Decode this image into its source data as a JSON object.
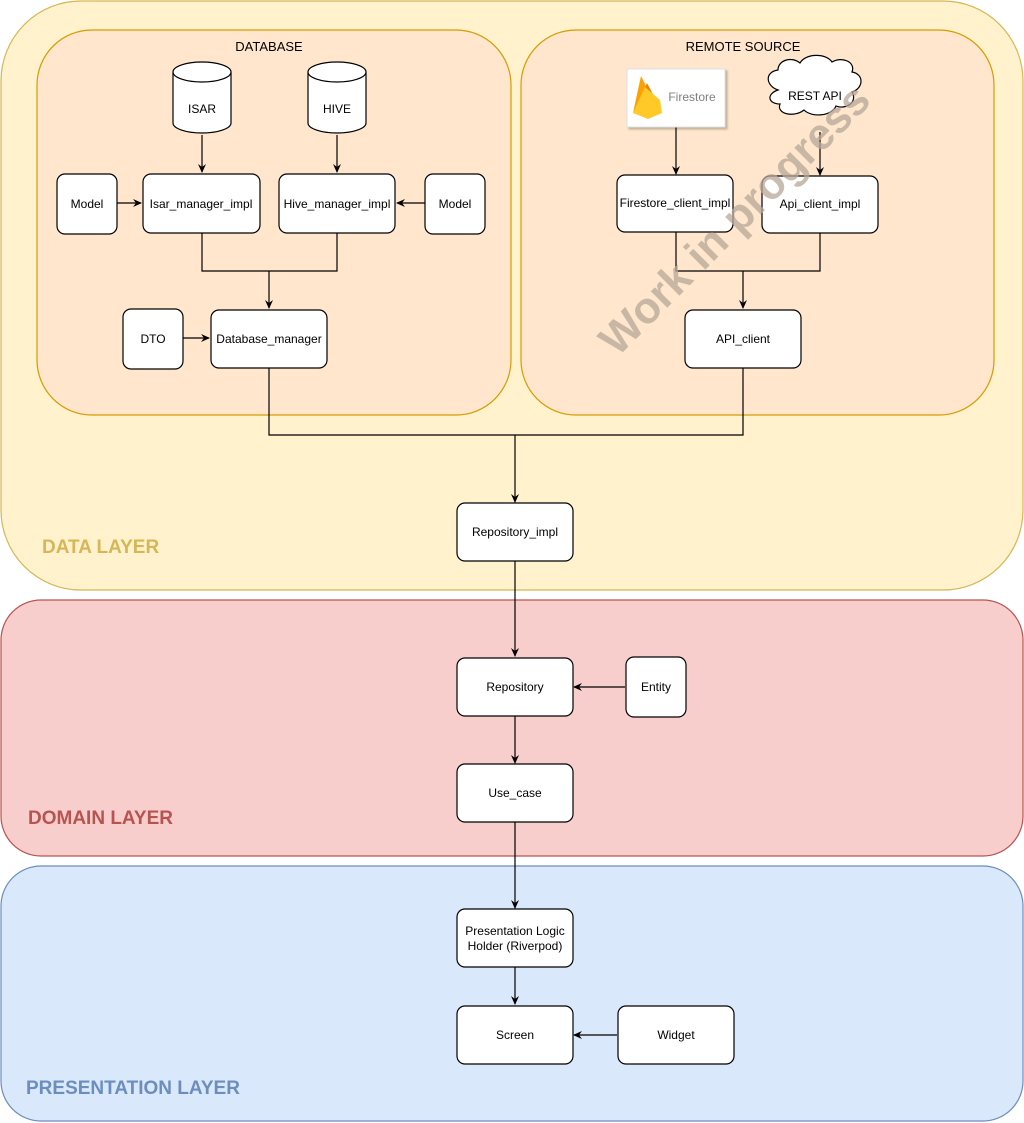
{
  "layers": {
    "data": {
      "label": "DATA LAYER",
      "fill": "#fff2cc",
      "stroke": "#d6b656",
      "label_color": "#d6b656"
    },
    "domain": {
      "label": "DOMAIN LAYER",
      "fill": "#f8cecc",
      "stroke": "#b85450",
      "label_color": "#b85450"
    },
    "presentation": {
      "label": "PRESENTATION LAYER",
      "fill": "#dae8fc",
      "stroke": "#6c8ebf",
      "label_color": "#6c8ebf"
    }
  },
  "groups": {
    "database": {
      "title": "DATABASE",
      "fill": "#ffe6cc",
      "stroke": "#d79b00"
    },
    "remote_source": {
      "title": "REMOTE SOURCE",
      "fill": "#ffe6cc",
      "stroke": "#d79b00"
    }
  },
  "nodes": {
    "isar": {
      "label": "ISAR",
      "shape": "cylinder"
    },
    "hive": {
      "label": "HIVE",
      "shape": "cylinder"
    },
    "model_left": {
      "label": "Model"
    },
    "isar_manager_impl": {
      "label": "Isar_manager_impl"
    },
    "hive_manager_impl": {
      "label": "Hive_manager_impl"
    },
    "model_right": {
      "label": "Model"
    },
    "dto": {
      "label": "DTO"
    },
    "database_manager": {
      "label": "Database_manager"
    },
    "firestore": {
      "label": "Firestore",
      "shape": "firebase-logo-card"
    },
    "rest_api": {
      "label": "REST API",
      "shape": "cloud"
    },
    "firestore_client_impl": {
      "label": "Firestore_client_impl"
    },
    "api_client_impl": {
      "label": "Api_client_impl"
    },
    "api_client": {
      "label": "API_client"
    },
    "repository_impl": {
      "label": "Repository_impl"
    },
    "repository": {
      "label": "Repository"
    },
    "entity": {
      "label": "Entity"
    },
    "use_case": {
      "label": "Use_case"
    },
    "presentation_logic_holder": {
      "label_line1": "Presentation Logic",
      "label_line2": "Holder (Riverpod)"
    },
    "screen": {
      "label": "Screen"
    },
    "widget": {
      "label": "Widget"
    }
  },
  "edges": [
    {
      "from": "ISAR",
      "to": "Isar_manager_impl"
    },
    {
      "from": "HIVE",
      "to": "Hive_manager_impl"
    },
    {
      "from": "Model",
      "to": "Isar_manager_impl"
    },
    {
      "from": "Model",
      "to": "Hive_manager_impl"
    },
    {
      "from": "Isar_manager_impl",
      "to": "Database_manager"
    },
    {
      "from": "Hive_manager_impl",
      "to": "Database_manager"
    },
    {
      "from": "DTO",
      "to": "Database_manager"
    },
    {
      "from": "Firestore",
      "to": "Firestore_client_impl"
    },
    {
      "from": "REST API",
      "to": "Api_client_impl"
    },
    {
      "from": "Firestore_client_impl",
      "to": "API_client"
    },
    {
      "from": "Api_client_impl",
      "to": "API_client"
    },
    {
      "from": "Database_manager",
      "to": "Repository_impl"
    },
    {
      "from": "API_client",
      "to": "Repository_impl"
    },
    {
      "from": "Repository_impl",
      "to": "Repository"
    },
    {
      "from": "Entity",
      "to": "Repository"
    },
    {
      "from": "Repository",
      "to": "Use_case"
    },
    {
      "from": "Use_case",
      "to": "Presentation Logic Holder (Riverpod)"
    },
    {
      "from": "Presentation Logic Holder (Riverpod)",
      "to": "Screen"
    },
    {
      "from": "Widget",
      "to": "Screen"
    }
  ],
  "watermark": {
    "text": "Work in progress",
    "color": "#b8a898"
  },
  "firebase_colors": {
    "flame_dark": "#f57c00",
    "flame_mid": "#ffa000",
    "flame_light": "#ffca28",
    "text": "#808080"
  }
}
